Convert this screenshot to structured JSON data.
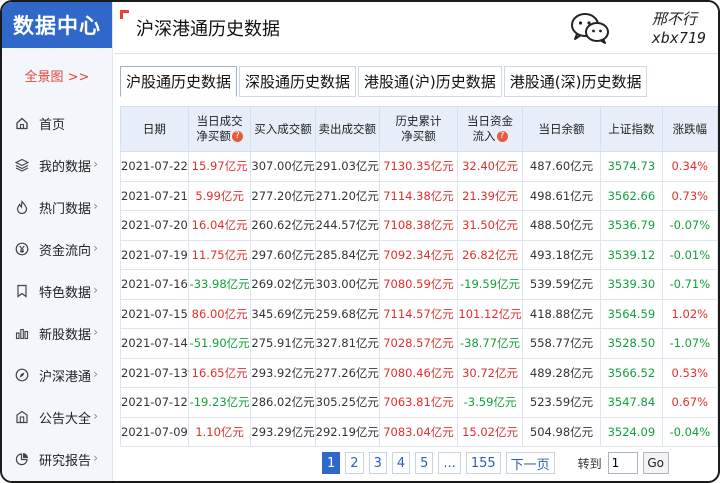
{
  "sidebar": {
    "brand": "数据中心",
    "overview": "全景图 >>",
    "items": [
      {
        "label": "首页",
        "icon": "home-icon",
        "chevron": false
      },
      {
        "label": "我的数据",
        "icon": "layers-icon",
        "chevron": true
      },
      {
        "label": "热门数据",
        "icon": "flame-icon",
        "chevron": true
      },
      {
        "label": "资金流向",
        "icon": "yen-circle-icon",
        "chevron": true
      },
      {
        "label": "特色数据",
        "icon": "bookmark-icon",
        "chevron": true
      },
      {
        "label": "新股数据",
        "icon": "bar-chart-icon",
        "chevron": true
      },
      {
        "label": "沪深港通",
        "icon": "compass-icon",
        "chevron": true
      },
      {
        "label": "公告大全",
        "icon": "building-icon",
        "chevron": true
      },
      {
        "label": "研究报告",
        "icon": "pie-chart-icon",
        "chevron": true
      }
    ],
    "chevron_glyph": "›"
  },
  "header": {
    "title": "沪深港通历史数据",
    "watermark_line1": "邢不行",
    "watermark_line2": "xbx719"
  },
  "tabs": [
    {
      "label": "沪股通历史数据",
      "active": true
    },
    {
      "label": "深股通历史数据",
      "active": false
    },
    {
      "label": "港股通(沪)历史数据",
      "active": false
    },
    {
      "label": "港股通(深)历史数据",
      "active": false
    }
  ],
  "table": {
    "columns": [
      {
        "l1": "日期",
        "l2": "",
        "q": false
      },
      {
        "l1": "当日成交",
        "l2": "净买额",
        "q": true
      },
      {
        "l1": "买入成交额",
        "l2": "",
        "q": false
      },
      {
        "l1": "卖出成交额",
        "l2": "",
        "q": false
      },
      {
        "l1": "历史累计",
        "l2": "净买额",
        "q": false
      },
      {
        "l1": "当日资金",
        "l2": "流入",
        "q": true
      },
      {
        "l1": "当日余额",
        "l2": "",
        "q": false
      },
      {
        "l1": "上证指数",
        "l2": "",
        "q": false
      },
      {
        "l1": "涨跌幅",
        "l2": "",
        "q": false
      }
    ],
    "question_glyph": "?",
    "rows": [
      [
        "2021-07-22",
        "15.97亿元",
        "307.00亿元",
        "291.03亿元",
        "7130.35亿元",
        "32.40亿元",
        "487.60亿元",
        "3574.73",
        "0.34%"
      ],
      [
        "2021-07-21",
        "5.99亿元",
        "277.20亿元",
        "271.20亿元",
        "7114.38亿元",
        "21.39亿元",
        "498.61亿元",
        "3562.66",
        "0.73%"
      ],
      [
        "2021-07-20",
        "16.04亿元",
        "260.62亿元",
        "244.57亿元",
        "7108.38亿元",
        "31.50亿元",
        "488.50亿元",
        "3536.79",
        "-0.07%"
      ],
      [
        "2021-07-19",
        "11.75亿元",
        "297.60亿元",
        "285.84亿元",
        "7092.34亿元",
        "26.82亿元",
        "493.18亿元",
        "3539.12",
        "-0.01%"
      ],
      [
        "2021-07-16",
        "-33.98亿元",
        "269.02亿元",
        "303.00亿元",
        "7080.59亿元",
        "-19.59亿元",
        "539.59亿元",
        "3539.30",
        "-0.71%"
      ],
      [
        "2021-07-15",
        "86.00亿元",
        "345.69亿元",
        "259.68亿元",
        "7114.57亿元",
        "101.12亿元",
        "418.88亿元",
        "3564.59",
        "1.02%"
      ],
      [
        "2021-07-14",
        "-51.90亿元",
        "275.91亿元",
        "327.81亿元",
        "7028.57亿元",
        "-38.77亿元",
        "558.77亿元",
        "3528.50",
        "-1.07%"
      ],
      [
        "2021-07-13",
        "16.65亿元",
        "293.92亿元",
        "277.26亿元",
        "7080.46亿元",
        "30.72亿元",
        "489.28亿元",
        "3566.52",
        "0.53%"
      ],
      [
        "2021-07-12",
        "-19.23亿元",
        "286.02亿元",
        "305.25亿元",
        "7063.81亿元",
        "-3.59亿元",
        "523.59亿元",
        "3547.84",
        "0.67%"
      ],
      [
        "2021-07-09",
        "1.10亿元",
        "293.29亿元",
        "292.19亿元",
        "7083.04亿元",
        "15.02亿元",
        "504.98亿元",
        "3524.09",
        "-0.04%"
      ]
    ]
  },
  "pagination": {
    "pages": [
      "1",
      "2",
      "3",
      "4",
      "5",
      "...",
      "155"
    ],
    "current": "1",
    "next_label": "下一页",
    "goto_label": "转到",
    "goto_value": "1",
    "go_label": "Go"
  },
  "colors": {
    "brand_blue": "#2f68c9",
    "up_red": "#e0302b",
    "down_green": "#12a13a",
    "header_bg": "#e8eef9"
  }
}
